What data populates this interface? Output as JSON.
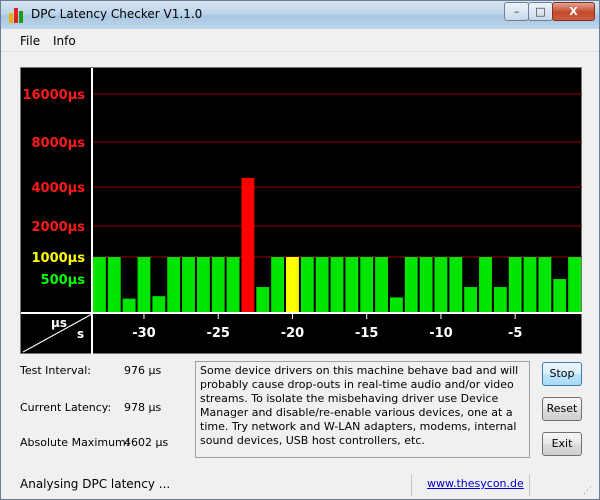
{
  "window": {
    "title": "DPC Latency Checker V1.1.0",
    "controls": {
      "minimize": "–",
      "maximize": "□",
      "close": "X"
    }
  },
  "menu": {
    "file": "File",
    "info": "Info"
  },
  "colors": {
    "green": "#00e600",
    "red": "#ff0000",
    "yellow": "#ffff00",
    "gridline": "#990000",
    "background": "#000000"
  },
  "chart_data": {
    "type": "bar",
    "y_scale": "log",
    "y_ticks": [
      {
        "label": "16000µs",
        "value": 16000,
        "color": "#ff1a1a"
      },
      {
        "label": "8000µs",
        "value": 8000,
        "color": "#ff1a1a"
      },
      {
        "label": "4000µs",
        "value": 4000,
        "color": "#ff1a1a"
      },
      {
        "label": "2000µs",
        "value": 2000,
        "color": "#ff1a1a"
      },
      {
        "label": "1000µs",
        "value": 1000,
        "color": "#ffff00"
      },
      {
        "label": "500µs",
        "value": 500,
        "color": "#00ff00"
      }
    ],
    "x_ticks": [
      {
        "label": "-30",
        "value": -30
      },
      {
        "label": "-25",
        "value": -25
      },
      {
        "label": "-20",
        "value": -20
      },
      {
        "label": "-15",
        "value": -15
      },
      {
        "label": "-10",
        "value": -10
      },
      {
        "label": "-5",
        "value": -5
      }
    ],
    "xlim": [
      -33,
      0
    ],
    "axis_corner": {
      "top": "µs",
      "bottom": "s"
    },
    "bars": [
      {
        "x": -33,
        "value": 1000,
        "color": "green"
      },
      {
        "x": -32,
        "value": 1000,
        "color": "green"
      },
      {
        "x": -31,
        "value": 290,
        "color": "green"
      },
      {
        "x": -30,
        "value": 1000,
        "color": "green"
      },
      {
        "x": -29,
        "value": 310,
        "color": "green"
      },
      {
        "x": -28,
        "value": 1000,
        "color": "green"
      },
      {
        "x": -27,
        "value": 1000,
        "color": "green"
      },
      {
        "x": -26,
        "value": 1000,
        "color": "green"
      },
      {
        "x": -25,
        "value": 1000,
        "color": "green"
      },
      {
        "x": -24,
        "value": 1000,
        "color": "green"
      },
      {
        "x": -23,
        "value": 4602,
        "color": "red"
      },
      {
        "x": -22,
        "value": 400,
        "color": "green"
      },
      {
        "x": -21,
        "value": 1000,
        "color": "green"
      },
      {
        "x": -20,
        "value": 1000,
        "color": "yellow"
      },
      {
        "x": -19,
        "value": 1000,
        "color": "green"
      },
      {
        "x": -18,
        "value": 1000,
        "color": "green"
      },
      {
        "x": -17,
        "value": 1000,
        "color": "green"
      },
      {
        "x": -16,
        "value": 1000,
        "color": "green"
      },
      {
        "x": -15,
        "value": 1000,
        "color": "green"
      },
      {
        "x": -14,
        "value": 1000,
        "color": "green"
      },
      {
        "x": -13,
        "value": 300,
        "color": "green"
      },
      {
        "x": -12,
        "value": 1000,
        "color": "green"
      },
      {
        "x": -11,
        "value": 1000,
        "color": "green"
      },
      {
        "x": -10,
        "value": 1000,
        "color": "green"
      },
      {
        "x": -9,
        "value": 1000,
        "color": "green"
      },
      {
        "x": -8,
        "value": 400,
        "color": "green"
      },
      {
        "x": -7,
        "value": 1000,
        "color": "green"
      },
      {
        "x": -6,
        "value": 400,
        "color": "green"
      },
      {
        "x": -5,
        "value": 1000,
        "color": "green"
      },
      {
        "x": -4,
        "value": 1000,
        "color": "green"
      },
      {
        "x": -3,
        "value": 1000,
        "color": "green"
      },
      {
        "x": -2,
        "value": 500,
        "color": "green"
      },
      {
        "x": -1,
        "value": 1000,
        "color": "green"
      }
    ]
  },
  "info": {
    "test_interval": {
      "label": "Test Interval:",
      "value": "976 µs"
    },
    "current_latency": {
      "label": "Current Latency:",
      "value": "978 µs"
    },
    "absolute_maximum": {
      "label": "Absolute Maximum:",
      "value": "4602 µs"
    }
  },
  "message": "Some device drivers on this machine behave bad and will probably cause drop-outs in real-time audio and/or video streams. To isolate the misbehaving driver use Device Manager and disable/re-enable various devices, one at a time. Try network and W-LAN adapters, modems, internal sound devices, USB host controllers, etc.",
  "buttons": {
    "stop": "Stop",
    "reset": "Reset",
    "exit": "Exit"
  },
  "status": {
    "text": "Analysing DPC latency ...",
    "link": "www.thesycon.de"
  }
}
